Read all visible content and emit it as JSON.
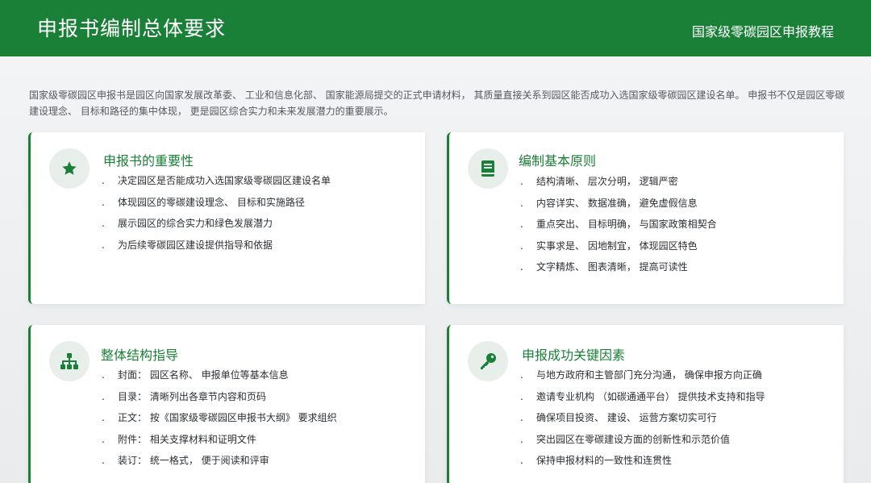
{
  "header": {
    "title": "申报书编制总体要求",
    "subtitle": "国家级零碳园区申报教程"
  },
  "intro": "国家级零碳园区申报书是园区向国家发展改革委、 工业和信息化部、 国家能源局提交的正式申请材料， 其质量直接关系到园区能否成功入选国家级零碳园区建设名单。 申报书不仅是园区零碳建设理念、 目标和路径的集中体现， 更是园区综合实力和未来发展潜力的重要展示。",
  "colors": {
    "brand": "#1a7f37",
    "card_bg": "#ffffff",
    "icon_bg": "#e8eee9"
  },
  "cards": [
    {
      "icon": "star-icon",
      "title": "申报书的重要性",
      "items": [
        "决定园区是否能成功入选国家级零碳园区建设名单",
        "体现园区的零碳建设理念、 目标和实施路径",
        "展示园区的综合实力和绿色发展潜力",
        "为后续零碳园区建设提供指导和依据"
      ]
    },
    {
      "icon": "book-icon",
      "title": "编制基本原则",
      "items": [
        "结构清晰、 层次分明， 逻辑严密",
        "内容详实、 数据准确， 避免虚假信息",
        "重点突出、 目标明确， 与国家政策相契合",
        "实事求是、 因地制宜， 体现园区特色",
        "文字精炼、 图表清晰， 提高可读性"
      ]
    },
    {
      "icon": "sitemap-icon",
      "title": "整体结构指导",
      "items": [
        "封面： 园区名称、 申报单位等基本信息",
        "目录： 清晰列出各章节内容和页码",
        "正文： 按《国家级零碳园区申报书大纲》 要求组织",
        "附件： 相关支撑材料和证明文件",
        "装订： 统一格式， 便于阅读和评审"
      ]
    },
    {
      "icon": "key-icon",
      "title": "申报成功关键因素",
      "items": [
        "与地方政府和主管部门充分沟通， 确保申报方向正确",
        "邀请专业机构 （如碳通通平台） 提供技术支持和指导",
        "确保项目投资、 建设、 运营方案切实可行",
        "突出园区在零碳建设方面的创新性和示范价值",
        "保持申报材料的一致性和连贯性"
      ]
    }
  ]
}
